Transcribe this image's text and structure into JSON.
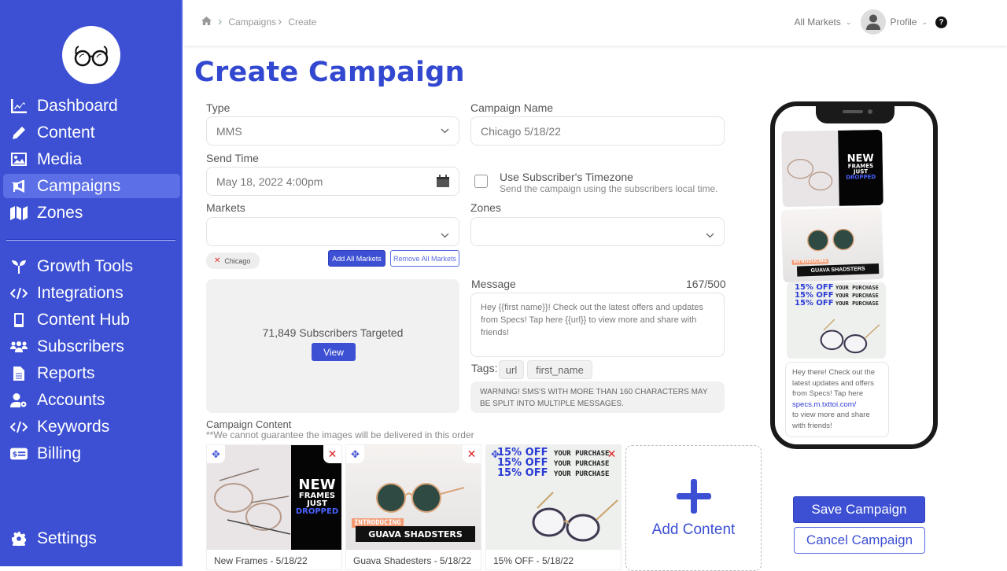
{
  "sidebar": {
    "items": [
      {
        "label": "Dashboard",
        "icon": "chart-line-icon"
      },
      {
        "label": "Content",
        "icon": "pencil-icon"
      },
      {
        "label": "Media",
        "icon": "image-icon"
      },
      {
        "label": "Campaigns",
        "icon": "bullhorn-icon",
        "active": true
      },
      {
        "label": "Zones",
        "icon": "map-icon"
      },
      {
        "label": "Growth Tools",
        "icon": "seedling-icon"
      },
      {
        "label": "Integrations",
        "icon": "code-icon"
      },
      {
        "label": "Content Hub",
        "icon": "mobile-icon"
      },
      {
        "label": "Subscribers",
        "icon": "users-icon"
      },
      {
        "label": "Reports",
        "icon": "file-icon"
      },
      {
        "label": "Accounts",
        "icon": "user-gear-icon"
      },
      {
        "label": "Keywords",
        "icon": "code-icon"
      },
      {
        "label": "Billing",
        "icon": "money-check-icon"
      }
    ],
    "settings_label": "Settings"
  },
  "topbar": {
    "breadcrumbs": [
      "Campaigns",
      "Create"
    ],
    "markets_label": "All Markets",
    "profile_label": "Profile",
    "help_glyph": "?"
  },
  "page": {
    "title": "Create Campaign"
  },
  "form": {
    "type_label": "Type",
    "type_value": "MMS",
    "campaign_name_label": "Campaign Name",
    "campaign_name_value": "Chicago 5/18/22",
    "send_time_label": "Send Time",
    "send_time_value": "May 18, 2022 4:00pm",
    "timezone_label": "Use Subscriber's Timezone",
    "timezone_help": "Send the campaign using the subscribers local time.",
    "timezone_checked": false,
    "markets_label": "Markets",
    "markets_value": "",
    "zones_label": "Zones",
    "zones_value": "",
    "selected_markets": [
      "Chicago"
    ],
    "add_all_markets": "Add All Markets",
    "remove_all_markets": "Remove All Markets",
    "subscribers_targeted": "71,849 Subscribers Targeted",
    "view_label": "View",
    "message_label": "Message",
    "message_count": "167/500",
    "message_value": "Hey {{first name}}! Check out the latest offers and updates from Specs! Tap here {{url}} to view more and share with friends!",
    "tags_label": "Tags:",
    "tags": [
      "url",
      "first_name"
    ],
    "warning": "WARNING! SMS'S WITH MORE THAN 160 CHARACTERS MAY BE SPLIT INTO MULTIPLE MESSAGES."
  },
  "content": {
    "label": "Campaign Content",
    "note": "**We cannot guarantee the images will be delivered in this order",
    "items": [
      {
        "caption": "New Frames - 5/18/22",
        "promo": [
          "NEW",
          "FRAMES",
          "JUST",
          "DROPPED"
        ]
      },
      {
        "caption": "Guava Shadesters - 5/18/22",
        "promo": [
          "INTRODUCING",
          "GUAVA SHADSTERS"
        ]
      },
      {
        "caption": "15% OFF - 5/18/22",
        "promo": [
          "15% OFF",
          "YOUR PURCHASE"
        ]
      }
    ],
    "add_label": "Add Content"
  },
  "preview": {
    "message_before": "Hey there! Check out the latest updates and offers from Specs! Tap here",
    "link": "specs.m.txttoi.com/",
    "message_after": "to view more and share with friends!"
  },
  "actions": {
    "save": "Save Campaign",
    "cancel": "Cancel Campaign"
  },
  "colors": {
    "brand": "#3d50d3",
    "danger": "#d22222"
  }
}
